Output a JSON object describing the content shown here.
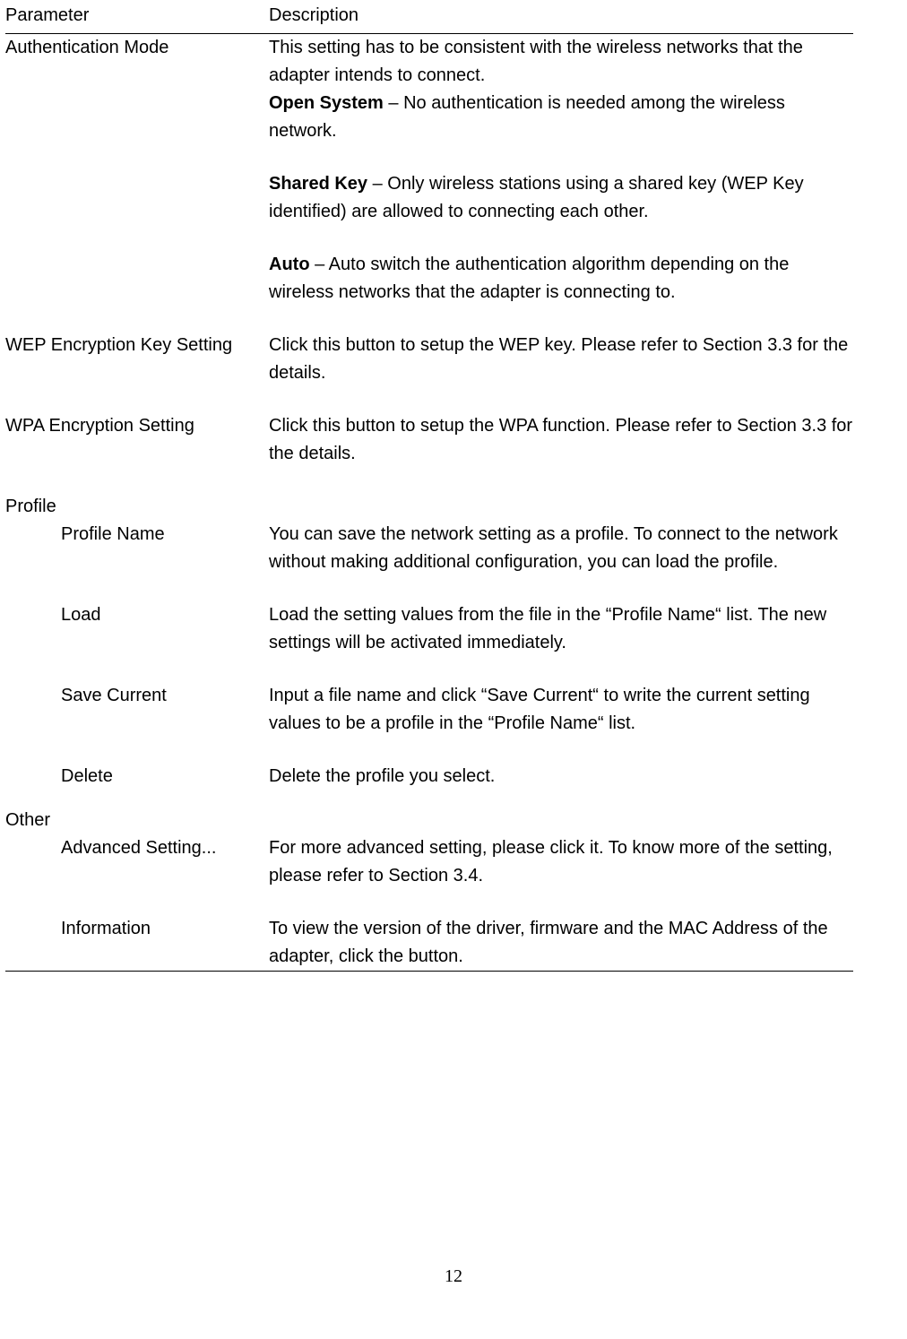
{
  "headers": {
    "parameter": "Parameter",
    "description": "Description"
  },
  "rows": {
    "auth_mode": {
      "param": "Authentication Mode",
      "intro": "This setting has to be consistent with the wireless networks that the adapter intends to connect.",
      "open_label": "Open System",
      "open_text": " – No authentication is needed among the wireless network.",
      "shared_label": "Shared Key",
      "shared_text": " – Only wireless stations using a shared key (WEP Key identified) are allowed to connecting each other.",
      "auto_label": "Auto",
      "auto_text": " – Auto switch the authentication algorithm depending on the wireless networks that the adapter is connecting to."
    },
    "wep": {
      "param": "WEP Encryption Key Setting",
      "desc": "Click this button to setup the WEP key. Please refer to Section 3.3 for the details."
    },
    "wpa": {
      "param": "WPA Encryption Setting",
      "desc": "Click this button to setup the WPA function. Please refer to Section 3.3 for the details."
    },
    "profile_section": "Profile",
    "profile_name": {
      "param": "Profile Name",
      "desc": "You can save the network setting as a profile. To connect to the network without making additional configuration, you can load the profile."
    },
    "load": {
      "param": "Load",
      "desc": "Load the setting values from the file in the “Profile Name“ list. The new settings will be activated immediately."
    },
    "save_current": {
      "param": "Save Current",
      "desc": "Input a file name and click “Save Current“ to write the current setting values to be a profile in the “Profile Name“ list."
    },
    "delete": {
      "param": "Delete",
      "desc": "Delete the profile you select."
    },
    "other_section": "Other",
    "advanced": {
      "param": "Advanced Setting...",
      "desc": "For more advanced setting, please click it. To know more of the setting, please refer to Section 3.4."
    },
    "information": {
      "param": "Information",
      "desc": "To view the version of the driver, firmware and the MAC Address of the adapter, click the button."
    }
  },
  "page_number": "12"
}
